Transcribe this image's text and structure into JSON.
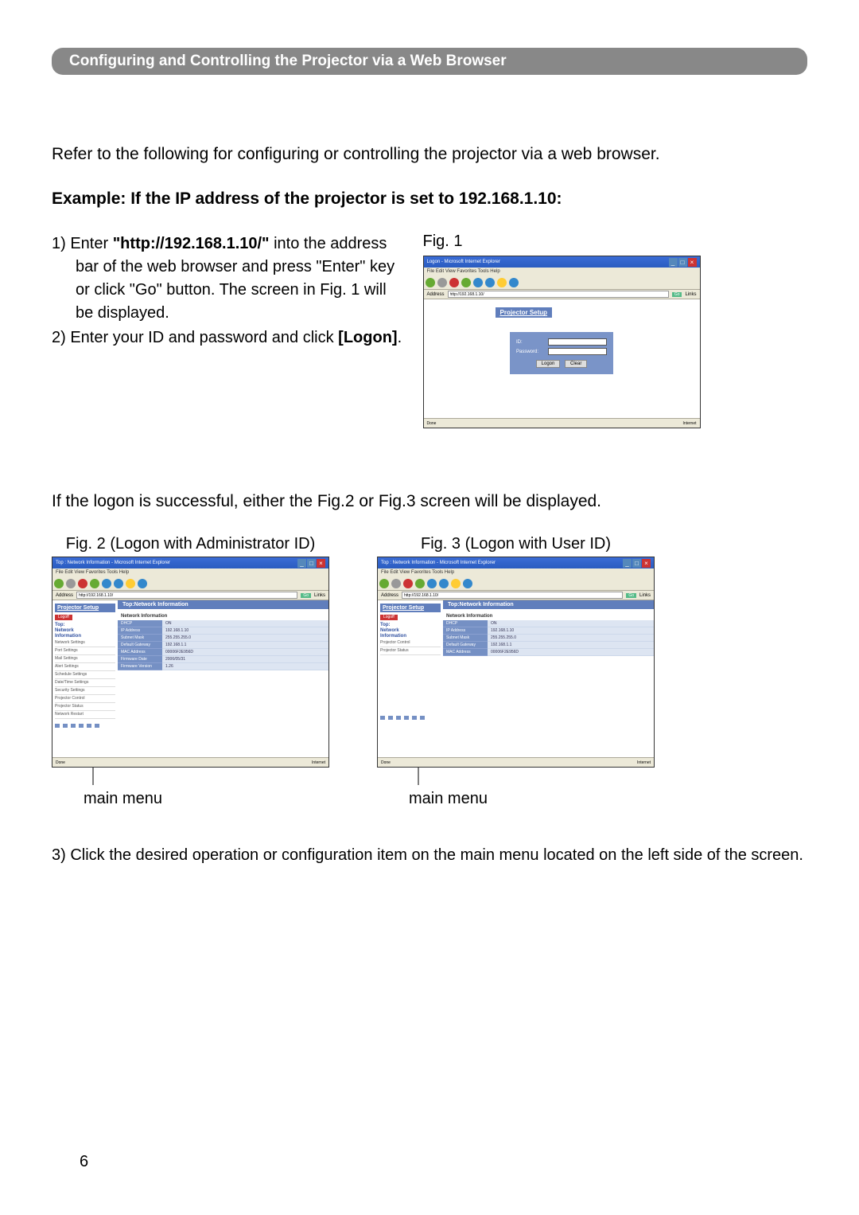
{
  "section_header": "Configuring and Controlling the Projector via a Web Browser",
  "intro": "Refer to the following for configuring or controlling the projector via a web browser.",
  "example_heading": "Example: If the IP address of the projector is set to 192.168.1.10:",
  "step1_prefix": "1) Enter ",
  "step1_url": "\"http://192.168.1.10/\"",
  "step1_suffix": " into the address bar of the web browser and press \"Enter\" key or click \"Go\" button. The screen in Fig. 1 will be displayed.",
  "step2_prefix": "2) Enter your ID and password and click ",
  "step2_button": "[Logon]",
  "step2_suffix": ".",
  "fig1_label": "Fig. 1",
  "success_text": "If the logon is successful, either the Fig.2 or Fig.3 screen will be displayed.",
  "fig2_caption": "Fig. 2 (Logon with Administrator ID)",
  "fig3_caption": "Fig. 3 (Logon with User ID)",
  "main_menu_label": "main menu",
  "step3": "3) Click the desired operation or configuration item on the main menu located on the left side of the screen.",
  "page_number": "6",
  "browser": {
    "title_logon": "Logon - Microsoft Internet Explorer",
    "title_netinfo": "Top : Network Information - Microsoft Internet Explorer",
    "menubar": "File  Edit  View  Favorites  Tools  Help",
    "address_label": "Address",
    "address_url": "http://192.168.1.10/",
    "go": "Go",
    "links": "Links",
    "done": "Done",
    "internet": "Internet"
  },
  "logon": {
    "setup_title": "Projector Setup",
    "id_label": "ID:",
    "pw_label": "Password:",
    "logon_btn": "Logon",
    "clear_btn": "Clear"
  },
  "netinfo": {
    "main_title": "Top:Network Information",
    "sub_header": "Network Information",
    "sidebar_title": "Projector Setup",
    "logoff": "Logoff",
    "nav_top1": "Top:",
    "nav_top2": "Network",
    "nav_top3": "Information",
    "admin_items": [
      "Network Settings",
      "Port Settings",
      "Mail Settings",
      "Alert Settings",
      "Schedule Settings",
      "Date/Time Settings",
      "Security Settings",
      "Projector Control",
      "Projector Status",
      "Network Restart"
    ],
    "user_items": [
      "Projector Control",
      "Projector Status"
    ],
    "rows": [
      {
        "label": "DHCP",
        "value": "ON"
      },
      {
        "label": "IP Address",
        "value": "192.168.1.10"
      },
      {
        "label": "Subnet Mask",
        "value": "255.255.255.0"
      },
      {
        "label": "Default Gateway",
        "value": "192.168.1.1"
      },
      {
        "label": "MAC Address",
        "value": "00006F2E956D"
      },
      {
        "label": "Firmware Date",
        "value": "2006/05/31"
      },
      {
        "label": "Firmware Version",
        "value": "1.26"
      }
    ],
    "rows_user": [
      {
        "label": "DHCP",
        "value": "ON"
      },
      {
        "label": "IP Address",
        "value": "192.168.1.10"
      },
      {
        "label": "Subnet Mask",
        "value": "255.255.255.0"
      },
      {
        "label": "Default Gateway",
        "value": "192.168.1.1"
      },
      {
        "label": "MAC Address",
        "value": "00006F2E956D"
      }
    ]
  }
}
